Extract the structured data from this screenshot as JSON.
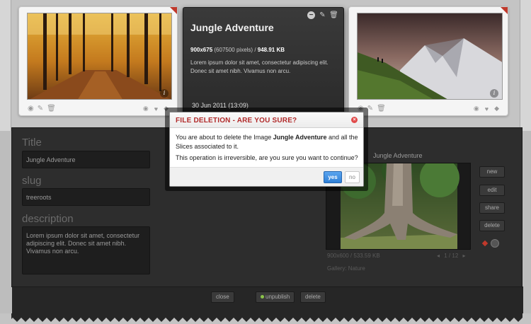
{
  "gallery": {
    "focused": {
      "title": "Jungle Adventure",
      "dims": "900x675",
      "pixels": "(607500 pixels) /",
      "filesize": "948.91 KB",
      "description": "Lorem ipsum dolor sit amet, consectetur adipiscing elit. Donec sit amet nibh. Vivamus non arcu.",
      "date": "30 Jun 2011 (13:09)"
    }
  },
  "editor": {
    "title_label": "Title",
    "title_value": "Jungle Adventure",
    "slug_label": "slug",
    "slug_value": "treeroots",
    "description_label": "description",
    "description_value": "Lorem ipsum dolor sit amet, consectetur adipiscing elit. Donec sit amet nibh. Vivamus non arcu.",
    "preview_title": "Jungle Adventure",
    "preview_size": "900x600 / 533.59 KB",
    "preview_pager": "1 / 12",
    "gallery_label": "Gallery: Nature",
    "actions": {
      "new": "new",
      "edit": "edit",
      "share": "share",
      "delete": "delete"
    }
  },
  "bottom_bar": {
    "close": "close",
    "unpublish": "unpublish",
    "delete": "delete"
  },
  "dialog": {
    "title": "FILE DELETION - ARE YOU SURE?",
    "line1_pre": "You are about to delete the Image",
    "line1_bold": "Jungle Adventure",
    "line1_post": "and all the Slices associated to it.",
    "line2": "This operation is irreversible, are you sure you want to continue?",
    "yes": "yes",
    "no": "no"
  },
  "colors": {
    "dialog_title": "#b12a2a",
    "yes_button": "#2f7fd6",
    "corner_flag": "#c0392b"
  }
}
